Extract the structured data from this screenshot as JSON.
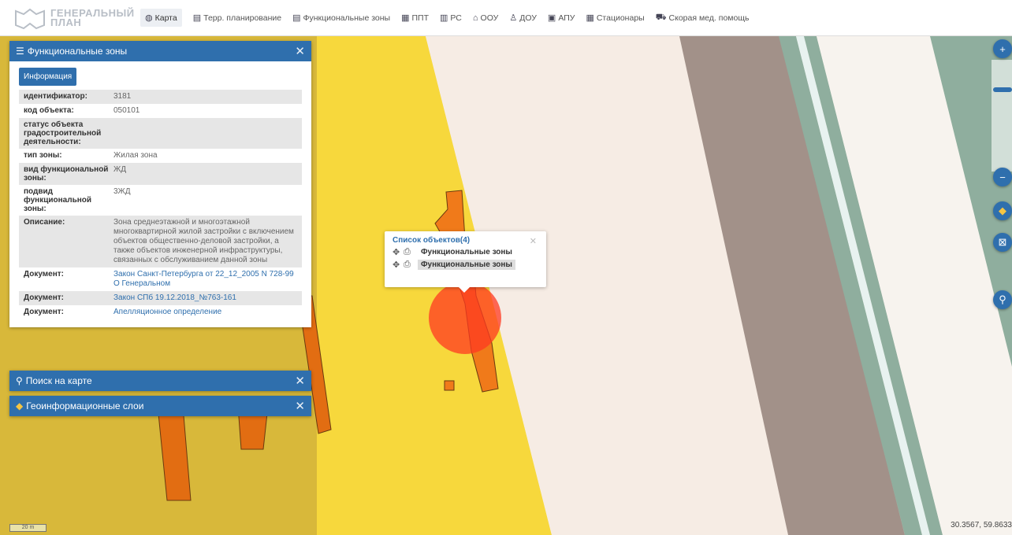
{
  "app": {
    "logo_line1": "ГЕНЕРАЛЬНЫЙ",
    "logo_line2": "ПЛАН"
  },
  "nav": [
    {
      "label": "Карта",
      "icon": "globe-icon",
      "glyph": "◍"
    },
    {
      "label": "Терр. планирование",
      "icon": "document-icon",
      "glyph": "▤"
    },
    {
      "label": "Функциональные зоны",
      "icon": "list-icon",
      "glyph": "▤"
    },
    {
      "label": "ППТ",
      "icon": "table-icon",
      "glyph": "▦"
    },
    {
      "label": "РС",
      "icon": "table-icon",
      "glyph": "▥"
    },
    {
      "label": "ООУ",
      "icon": "school-icon",
      "glyph": "⌂"
    },
    {
      "label": "ДОУ",
      "icon": "kindergarten-icon",
      "glyph": "♙"
    },
    {
      "label": "АПУ",
      "icon": "clinic-icon",
      "glyph": "▣"
    },
    {
      "label": "Стационары",
      "icon": "hospital-icon",
      "glyph": "▦"
    },
    {
      "label": "Скорая мед. помощь",
      "icon": "ambulance-icon",
      "glyph": "⛟"
    }
  ],
  "panel_zones": {
    "title": "Функциональные зоны",
    "info_button": "Информация",
    "rows": [
      {
        "key": "идентификатор:",
        "value": "3181",
        "link": false
      },
      {
        "key": "код объекта:",
        "value": "050101",
        "link": false
      },
      {
        "key": "статус объекта градостроительной деятельности:",
        "value": "",
        "link": false
      },
      {
        "key": "тип зоны:",
        "value": "Жилая зона",
        "link": false
      },
      {
        "key": "вид функциональной зоны:",
        "value": "ЖД",
        "link": false
      },
      {
        "key": "подвид функциональной зоны:",
        "value": "3ЖД",
        "link": false
      },
      {
        "key": "Описание:",
        "value": "Зона среднеэтажной и многоэтажной многоквартирной жилой застройки с включением объектов общественно-деловой застройки, а также объектов инженерной инфраструктуры, связанных с обслуживанием данной зоны",
        "link": false
      },
      {
        "key": "Документ:",
        "value": "Закон Санкт-Петербурга от 22_12_2005 N 728-99 О Генеральном",
        "link": true
      },
      {
        "key": "Документ:",
        "value": "Закон СПб 19.12.2018_№763-161",
        "link": true
      },
      {
        "key": "Документ:",
        "value": "Апелляционное определение",
        "link": true
      }
    ]
  },
  "panel_search": {
    "title": "Поиск на карте"
  },
  "panel_layers": {
    "title": "Геоинформационные слои"
  },
  "close_glyph": "✕",
  "popup": {
    "title": "Список объектов(4)",
    "items": [
      "Функциональные зоны",
      "Функциональные зоны"
    ]
  },
  "map": {
    "scale_label": "20 m",
    "coordinates": "30.3567, 59.8633"
  },
  "colors": {
    "accent": "#2f6fad",
    "zone_yellow": "#f5d53a",
    "zone_orange": "#f07a1a",
    "road_gray": "#a08f88",
    "green_strip": "#8fb0a0"
  }
}
